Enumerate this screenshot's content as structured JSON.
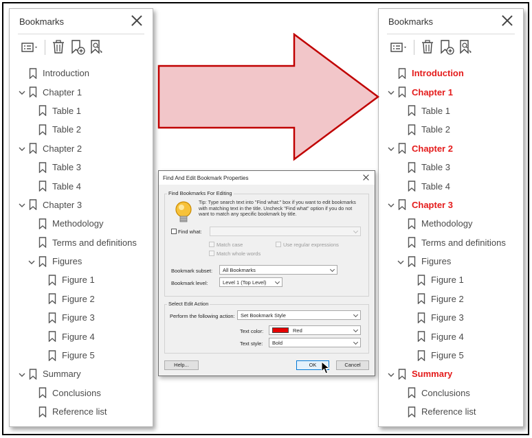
{
  "left_panel": {
    "title": "Bookmarks",
    "rows": [
      {
        "label": "Introduction",
        "level": 0,
        "expandable": false,
        "styled": false
      },
      {
        "label": "Chapter 1",
        "level": 0,
        "expandable": true,
        "styled": false
      },
      {
        "label": "Table 1",
        "level": 1,
        "expandable": false,
        "styled": false
      },
      {
        "label": "Table 2",
        "level": 1,
        "expandable": false,
        "styled": false
      },
      {
        "label": "Chapter 2",
        "level": 0,
        "expandable": true,
        "styled": false
      },
      {
        "label": "Table 3",
        "level": 1,
        "expandable": false,
        "styled": false
      },
      {
        "label": "Table 4",
        "level": 1,
        "expandable": false,
        "styled": false
      },
      {
        "label": "Chapter 3",
        "level": 0,
        "expandable": true,
        "styled": false
      },
      {
        "label": "Methodology",
        "level": 1,
        "expandable": false,
        "styled": false
      },
      {
        "label": "Terms and definitions",
        "level": 1,
        "expandable": false,
        "styled": false
      },
      {
        "label": "Figures",
        "level": 1,
        "expandable": true,
        "styled": false
      },
      {
        "label": "Figure 1",
        "level": 2,
        "expandable": false,
        "styled": false
      },
      {
        "label": "Figure 2",
        "level": 2,
        "expandable": false,
        "styled": false
      },
      {
        "label": "Figure 3",
        "level": 2,
        "expandable": false,
        "styled": false
      },
      {
        "label": "Figure 4",
        "level": 2,
        "expandable": false,
        "styled": false
      },
      {
        "label": "Figure 5",
        "level": 2,
        "expandable": false,
        "styled": false
      },
      {
        "label": "Summary",
        "level": 0,
        "expandable": true,
        "styled": false
      },
      {
        "label": "Conclusions",
        "level": 1,
        "expandable": false,
        "styled": false
      },
      {
        "label": "Reference list",
        "level": 1,
        "expandable": false,
        "styled": false
      }
    ]
  },
  "right_panel": {
    "title": "Bookmarks",
    "rows": [
      {
        "label": "Introduction",
        "level": 0,
        "expandable": false,
        "styled": true
      },
      {
        "label": "Chapter 1",
        "level": 0,
        "expandable": true,
        "styled": true
      },
      {
        "label": "Table 1",
        "level": 1,
        "expandable": false,
        "styled": false
      },
      {
        "label": "Table 2",
        "level": 1,
        "expandable": false,
        "styled": false
      },
      {
        "label": "Chapter 2",
        "level": 0,
        "expandable": true,
        "styled": true
      },
      {
        "label": "Table 3",
        "level": 1,
        "expandable": false,
        "styled": false
      },
      {
        "label": "Table 4",
        "level": 1,
        "expandable": false,
        "styled": false
      },
      {
        "label": "Chapter 3",
        "level": 0,
        "expandable": true,
        "styled": true
      },
      {
        "label": "Methodology",
        "level": 1,
        "expandable": false,
        "styled": false
      },
      {
        "label": "Terms and definitions",
        "level": 1,
        "expandable": false,
        "styled": false
      },
      {
        "label": "Figures",
        "level": 1,
        "expandable": true,
        "styled": false
      },
      {
        "label": "Figure 1",
        "level": 2,
        "expandable": false,
        "styled": false
      },
      {
        "label": "Figure 2",
        "level": 2,
        "expandable": false,
        "styled": false
      },
      {
        "label": "Figure 3",
        "level": 2,
        "expandable": false,
        "styled": false
      },
      {
        "label": "Figure 4",
        "level": 2,
        "expandable": false,
        "styled": false
      },
      {
        "label": "Figure 5",
        "level": 2,
        "expandable": false,
        "styled": false
      },
      {
        "label": "Summary",
        "level": 0,
        "expandable": true,
        "styled": true
      },
      {
        "label": "Conclusions",
        "level": 1,
        "expandable": false,
        "styled": false
      },
      {
        "label": "Reference list",
        "level": 1,
        "expandable": false,
        "styled": false
      }
    ]
  },
  "toolbar_icons": [
    "options-menu-icon",
    "trash-icon",
    "new-bookmark-icon",
    "bookmark-search-icon"
  ],
  "dialog": {
    "title": "Find And Edit Bookmark Properties",
    "find_group_label": "Find Bookmarks For Editing",
    "tip": "Tip: Type search text into \"Find what:\" box if you want to edit bookmarks with matching text in the title. Uncheck \"Find what\" option if you do not want to match any specific bookmark by title.",
    "find_what_label": "Find what:",
    "find_what_value": "",
    "match_case_label": "Match case",
    "match_whole_words_label": "Match whole words",
    "use_regex_label": "Use regular expressions",
    "bookmark_subset_label": "Bookmark subset:",
    "bookmark_subset_value": "All Bookmarks",
    "bookmark_level_label": "Bookmark level:",
    "bookmark_level_value": "Level 1 (Top Level)",
    "edit_group_label": "Select Edit Action",
    "action_label": "Perform the following action:",
    "action_value": "Set Bookmark Style",
    "text_color_label": "Text color:",
    "text_color_value": "Red",
    "text_style_label": "Text style:",
    "text_style_value": "Bold",
    "help_button": "Help...",
    "ok_button": "OK",
    "cancel_button": "Cancel"
  },
  "colors": {
    "highlight_red": "#e41b1b",
    "arrow_fill": "#f2c6c9",
    "arrow_stroke": "#c00000",
    "swatch_red": "#e60000"
  }
}
